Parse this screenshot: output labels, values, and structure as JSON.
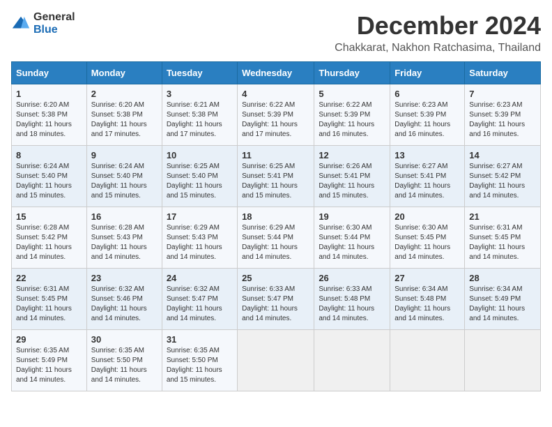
{
  "header": {
    "logo_general": "General",
    "logo_blue": "Blue",
    "month_title": "December 2024",
    "location": "Chakkarat, Nakhon Ratchasima, Thailand"
  },
  "weekdays": [
    "Sunday",
    "Monday",
    "Tuesday",
    "Wednesday",
    "Thursday",
    "Friday",
    "Saturday"
  ],
  "weeks": [
    [
      {
        "day": 1,
        "sunrise": "6:20 AM",
        "sunset": "5:38 PM",
        "daylight": "11 hours and 18 minutes"
      },
      {
        "day": 2,
        "sunrise": "6:20 AM",
        "sunset": "5:38 PM",
        "daylight": "11 hours and 17 minutes"
      },
      {
        "day": 3,
        "sunrise": "6:21 AM",
        "sunset": "5:38 PM",
        "daylight": "11 hours and 17 minutes"
      },
      {
        "day": 4,
        "sunrise": "6:22 AM",
        "sunset": "5:39 PM",
        "daylight": "11 hours and 17 minutes"
      },
      {
        "day": 5,
        "sunrise": "6:22 AM",
        "sunset": "5:39 PM",
        "daylight": "11 hours and 16 minutes"
      },
      {
        "day": 6,
        "sunrise": "6:23 AM",
        "sunset": "5:39 PM",
        "daylight": "11 hours and 16 minutes"
      },
      {
        "day": 7,
        "sunrise": "6:23 AM",
        "sunset": "5:39 PM",
        "daylight": "11 hours and 16 minutes"
      }
    ],
    [
      {
        "day": 8,
        "sunrise": "6:24 AM",
        "sunset": "5:40 PM",
        "daylight": "11 hours and 15 minutes"
      },
      {
        "day": 9,
        "sunrise": "6:24 AM",
        "sunset": "5:40 PM",
        "daylight": "11 hours and 15 minutes"
      },
      {
        "day": 10,
        "sunrise": "6:25 AM",
        "sunset": "5:40 PM",
        "daylight": "11 hours and 15 minutes"
      },
      {
        "day": 11,
        "sunrise": "6:25 AM",
        "sunset": "5:41 PM",
        "daylight": "11 hours and 15 minutes"
      },
      {
        "day": 12,
        "sunrise": "6:26 AM",
        "sunset": "5:41 PM",
        "daylight": "11 hours and 15 minutes"
      },
      {
        "day": 13,
        "sunrise": "6:27 AM",
        "sunset": "5:41 PM",
        "daylight": "11 hours and 14 minutes"
      },
      {
        "day": 14,
        "sunrise": "6:27 AM",
        "sunset": "5:42 PM",
        "daylight": "11 hours and 14 minutes"
      }
    ],
    [
      {
        "day": 15,
        "sunrise": "6:28 AM",
        "sunset": "5:42 PM",
        "daylight": "11 hours and 14 minutes"
      },
      {
        "day": 16,
        "sunrise": "6:28 AM",
        "sunset": "5:43 PM",
        "daylight": "11 hours and 14 minutes"
      },
      {
        "day": 17,
        "sunrise": "6:29 AM",
        "sunset": "5:43 PM",
        "daylight": "11 hours and 14 minutes"
      },
      {
        "day": 18,
        "sunrise": "6:29 AM",
        "sunset": "5:44 PM",
        "daylight": "11 hours and 14 minutes"
      },
      {
        "day": 19,
        "sunrise": "6:30 AM",
        "sunset": "5:44 PM",
        "daylight": "11 hours and 14 minutes"
      },
      {
        "day": 20,
        "sunrise": "6:30 AM",
        "sunset": "5:45 PM",
        "daylight": "11 hours and 14 minutes"
      },
      {
        "day": 21,
        "sunrise": "6:31 AM",
        "sunset": "5:45 PM",
        "daylight": "11 hours and 14 minutes"
      }
    ],
    [
      {
        "day": 22,
        "sunrise": "6:31 AM",
        "sunset": "5:45 PM",
        "daylight": "11 hours and 14 minutes"
      },
      {
        "day": 23,
        "sunrise": "6:32 AM",
        "sunset": "5:46 PM",
        "daylight": "11 hours and 14 minutes"
      },
      {
        "day": 24,
        "sunrise": "6:32 AM",
        "sunset": "5:47 PM",
        "daylight": "11 hours and 14 minutes"
      },
      {
        "day": 25,
        "sunrise": "6:33 AM",
        "sunset": "5:47 PM",
        "daylight": "11 hours and 14 minutes"
      },
      {
        "day": 26,
        "sunrise": "6:33 AM",
        "sunset": "5:48 PM",
        "daylight": "11 hours and 14 minutes"
      },
      {
        "day": 27,
        "sunrise": "6:34 AM",
        "sunset": "5:48 PM",
        "daylight": "11 hours and 14 minutes"
      },
      {
        "day": 28,
        "sunrise": "6:34 AM",
        "sunset": "5:49 PM",
        "daylight": "11 hours and 14 minutes"
      }
    ],
    [
      {
        "day": 29,
        "sunrise": "6:35 AM",
        "sunset": "5:49 PM",
        "daylight": "11 hours and 14 minutes"
      },
      {
        "day": 30,
        "sunrise": "6:35 AM",
        "sunset": "5:50 PM",
        "daylight": "11 hours and 14 minutes"
      },
      {
        "day": 31,
        "sunrise": "6:35 AM",
        "sunset": "5:50 PM",
        "daylight": "11 hours and 15 minutes"
      },
      null,
      null,
      null,
      null
    ]
  ]
}
